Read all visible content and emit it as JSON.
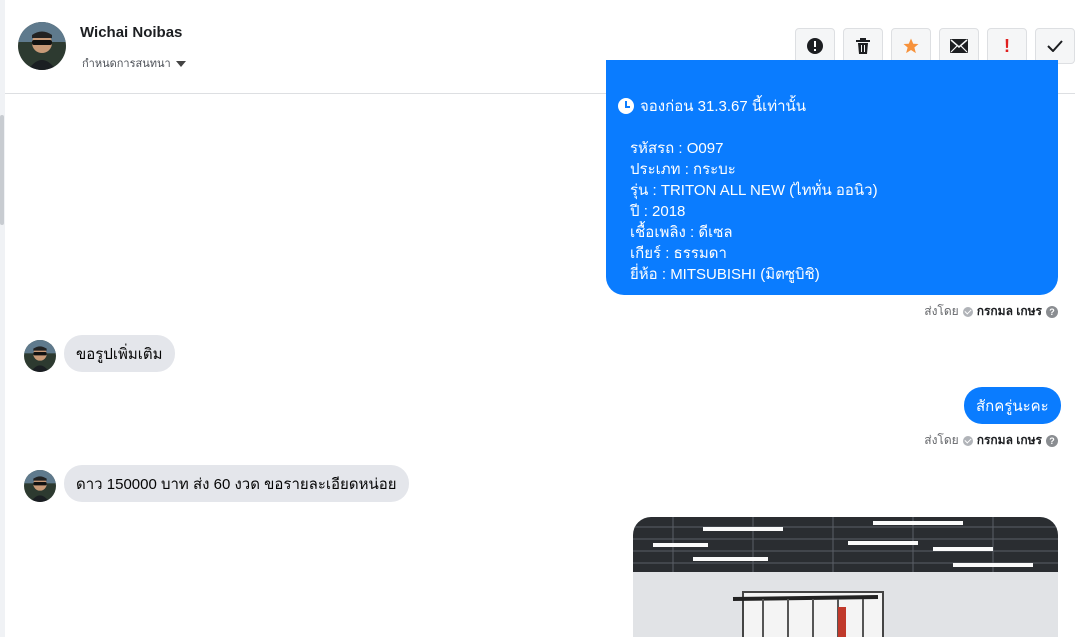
{
  "header": {
    "contact_name": "Wichai Noibas",
    "assign_label": "กำหนดการสนทนา",
    "toolbar": [
      {
        "icon": "alert-circle-icon",
        "name": "report-button"
      },
      {
        "icon": "trash-icon",
        "name": "delete-button"
      },
      {
        "icon": "star-icon",
        "name": "star-button"
      },
      {
        "icon": "envelope-icon",
        "name": "mark-unread-button"
      },
      {
        "icon": "exclamation-icon",
        "name": "priority-button",
        "glyph": "!"
      },
      {
        "icon": "check-icon",
        "name": "mark-done-button"
      }
    ]
  },
  "conversation": {
    "card": {
      "headline": "จองก่อน 31.3.67 นี้เท่านั้น",
      "lines": [
        "รหัสรถ : O097",
        "ประเภท : กระบะ",
        "รุ่น : TRITON ALL NEW (ไททั่น ออนิว)",
        "ปี : 2018",
        "เชื้อเพลิง : ดีเซล",
        "เกียร์ : ธรรมดา",
        "ยี่ห้อ : MITSUBISHI (มิตซูบิชิ)"
      ]
    },
    "sent_by_prefix": "ส่งโดย",
    "sent_by_name": "กรกมล เกษร",
    "incoming_1": "ขอรูปเพิ่มเติม",
    "outgoing_1": "สักครู่นะคะ",
    "incoming_2": "ดาว 150000 บาท ส่ง 60 งวด ขอรายละเอียดหน่อย"
  },
  "colors": {
    "outgoing_bubble": "#0a7cff",
    "incoming_bubble": "#e4e6eb",
    "star": "#f7923b",
    "priority": "#e02020"
  }
}
